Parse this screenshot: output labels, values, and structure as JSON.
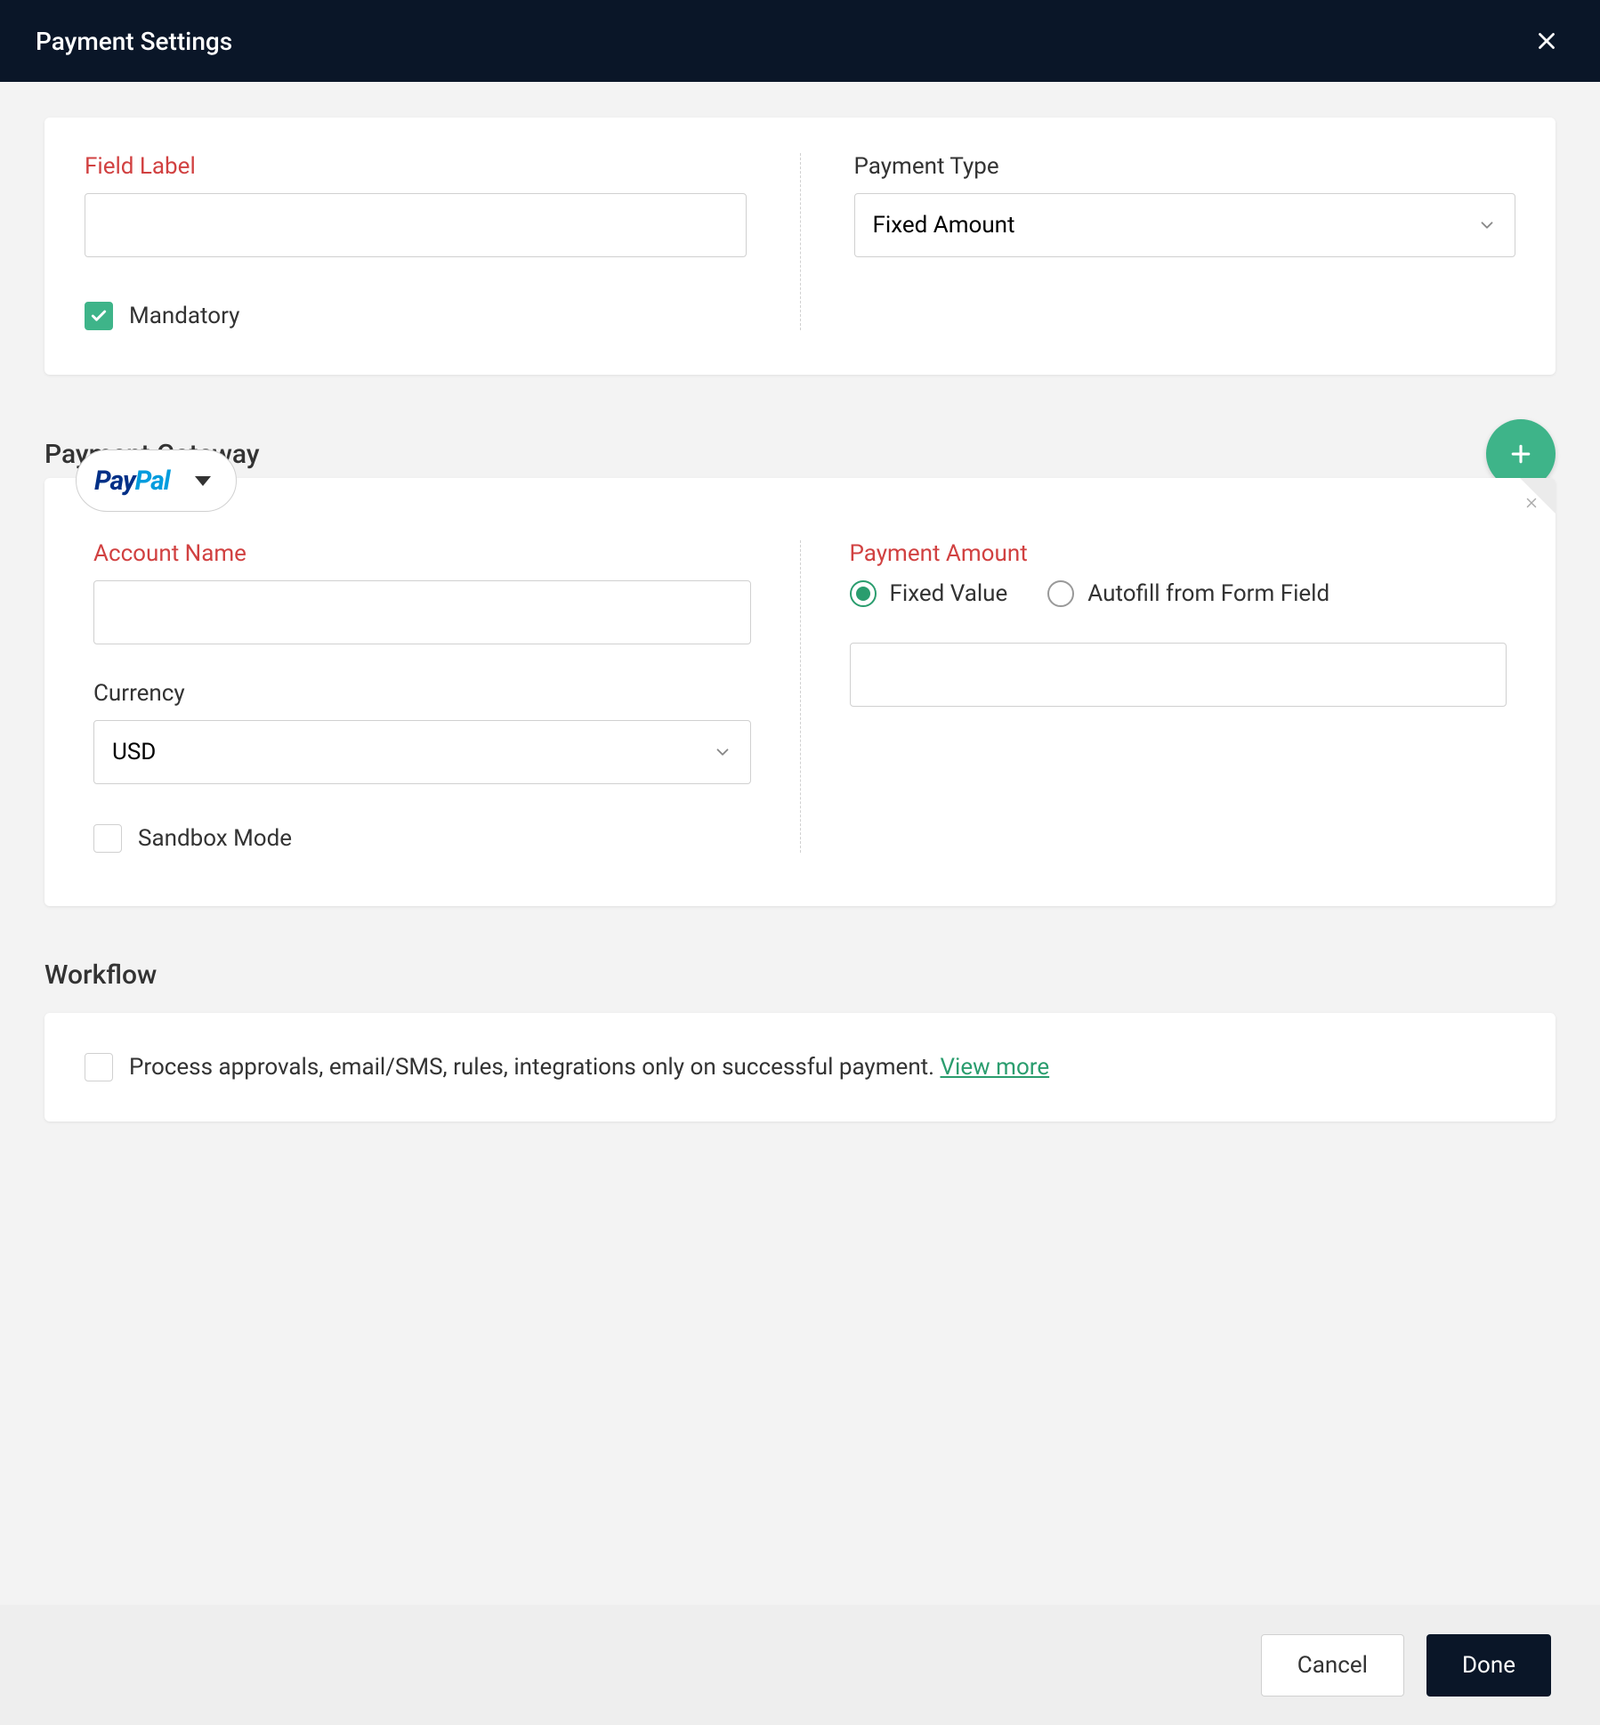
{
  "header": {
    "title": "Payment Settings"
  },
  "fields": {
    "field_label_label": "Field Label",
    "field_label_value": "",
    "mandatory_label": "Mandatory",
    "mandatory_checked": true,
    "payment_type_label": "Payment Type",
    "payment_type_value": "Fixed Amount"
  },
  "gateway": {
    "section_title": "Payment Gateway",
    "provider": "PayPal",
    "account_name_label": "Account Name",
    "account_name_value": "",
    "currency_label": "Currency",
    "currency_value": "USD",
    "sandbox_label": "Sandbox Mode",
    "sandbox_checked": false,
    "payment_amount_label": "Payment Amount",
    "radio_fixed_label": "Fixed Value",
    "radio_autofill_label": "Autofill from Form Field",
    "radio_selected": "fixed",
    "amount_value": ""
  },
  "workflow": {
    "section_title": "Workflow",
    "description": "Process approvals, email/SMS, rules, integrations only on successful payment. ",
    "view_more_label": "View more",
    "checked": false
  },
  "footer": {
    "cancel_label": "Cancel",
    "done_label": "Done"
  }
}
